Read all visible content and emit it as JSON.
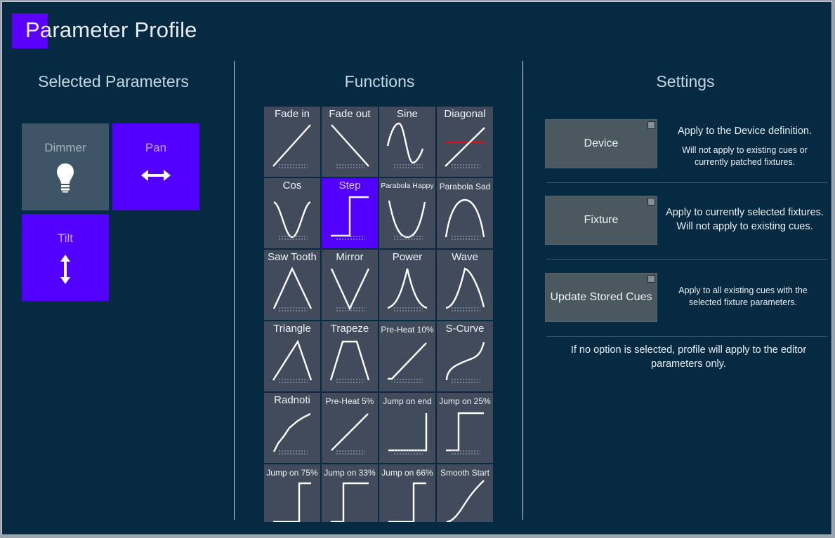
{
  "window": {
    "title": "Parameter Profile"
  },
  "columns": {
    "selected_parameters": "Selected Parameters",
    "functions": "Functions",
    "settings": "Settings"
  },
  "parameters": [
    {
      "label": "Dimmer",
      "icon": "lightbulb-icon",
      "selected": false
    },
    {
      "label": "Pan",
      "icon": "horizontal-arrows-icon",
      "selected": true
    },
    {
      "label": "Tilt",
      "icon": "vertical-arrows-icon",
      "selected": true
    }
  ],
  "functions": [
    {
      "label": "Fade in",
      "curve": "fade-in",
      "selected": false
    },
    {
      "label": "Fade out",
      "curve": "fade-out",
      "selected": false
    },
    {
      "label": "Sine",
      "curve": "sine",
      "selected": false
    },
    {
      "label": "Diagonal",
      "curve": "diagonal",
      "selected": false
    },
    {
      "label": "Cos",
      "curve": "cos",
      "selected": false
    },
    {
      "label": "Step",
      "curve": "step",
      "selected": true
    },
    {
      "label": "Parabola Happy",
      "curve": "parabola-happy",
      "selected": false
    },
    {
      "label": "Parabola Sad",
      "curve": "parabola-sad",
      "selected": false
    },
    {
      "label": "Saw Tooth",
      "curve": "saw-tooth",
      "selected": false
    },
    {
      "label": "Mirror",
      "curve": "mirror",
      "selected": false
    },
    {
      "label": "Power",
      "curve": "power",
      "selected": false
    },
    {
      "label": "Wave",
      "curve": "wave",
      "selected": false
    },
    {
      "label": "Triangle",
      "curve": "triangle",
      "selected": false
    },
    {
      "label": "Trapeze",
      "curve": "trapeze",
      "selected": false
    },
    {
      "label": "Pre-Heat 10%",
      "curve": "preheat-10",
      "selected": false
    },
    {
      "label": "S-Curve",
      "curve": "s-curve",
      "selected": false
    },
    {
      "label": "Radnoti",
      "curve": "radnoti",
      "selected": false
    },
    {
      "label": "Pre-Heat 5%",
      "curve": "preheat-5",
      "selected": false
    },
    {
      "label": "Jump on end",
      "curve": "jump-end",
      "selected": false
    },
    {
      "label": "Jump on 25%",
      "curve": "jump-25",
      "selected": false
    },
    {
      "label": "Jump on 75%",
      "curve": "jump-75",
      "selected": false
    },
    {
      "label": "Jump on 33%",
      "curve": "jump-33",
      "selected": false
    },
    {
      "label": "Jump on 66%",
      "curve": "jump-66",
      "selected": false
    },
    {
      "label": "Smooth Start",
      "curve": "smooth-start",
      "selected": false
    }
  ],
  "settings": {
    "device": {
      "label": "Device",
      "checked": false,
      "desc_main": "Apply to the Device definition.",
      "desc_sub": "Will not apply to existing cues or currently patched fixtures."
    },
    "fixture": {
      "label": "Fixture",
      "checked": false,
      "desc_main": "Apply to currently selected fixtures. Will not apply to existing cues."
    },
    "update_cues": {
      "label": "Update Stored Cues",
      "checked": false,
      "desc_main": "Apply to all existing cues with the selected fixture parameters."
    },
    "footer_note": "If no option is selected, profile will apply to the editor parameters only."
  },
  "colors": {
    "background": "#062a42",
    "accent_selected": "#5200ff",
    "tile_unselected": "#414b5c",
    "diagonal_marker": "#e0101a"
  }
}
